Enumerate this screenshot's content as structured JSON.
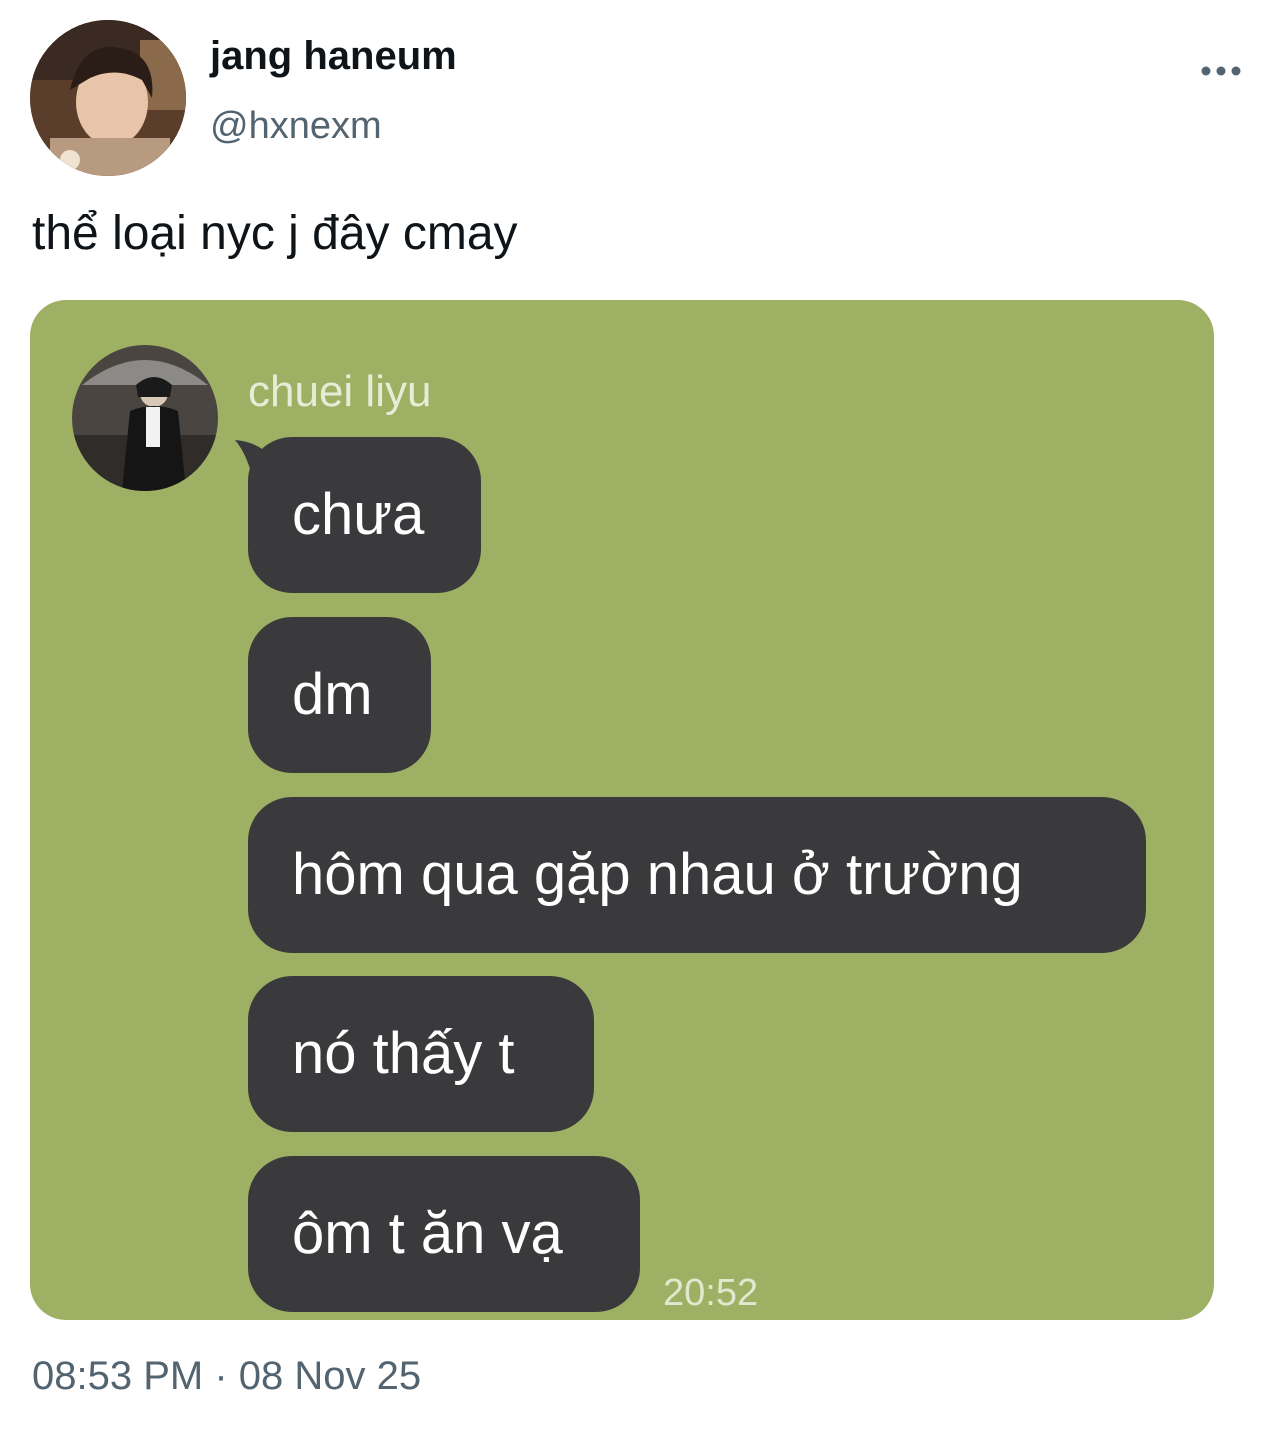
{
  "tweet": {
    "display_name": "jang haneum",
    "handle": "@hxnexm",
    "more_icon": "more-horizontal-icon",
    "text": "thể loại nyc j đây cmay",
    "time": "08:53 PM",
    "separator": "·",
    "date": "08 Nov 25"
  },
  "media": {
    "background_color": "#9eb063",
    "bubble_color": "#3a3a3c",
    "sender_name": "chuei liyu",
    "messages": [
      "chưa",
      "dm",
      "hôm qua gặp nhau ở trường",
      "nó thấy t",
      "ôm t ăn vạ"
    ],
    "time": "20:52"
  }
}
